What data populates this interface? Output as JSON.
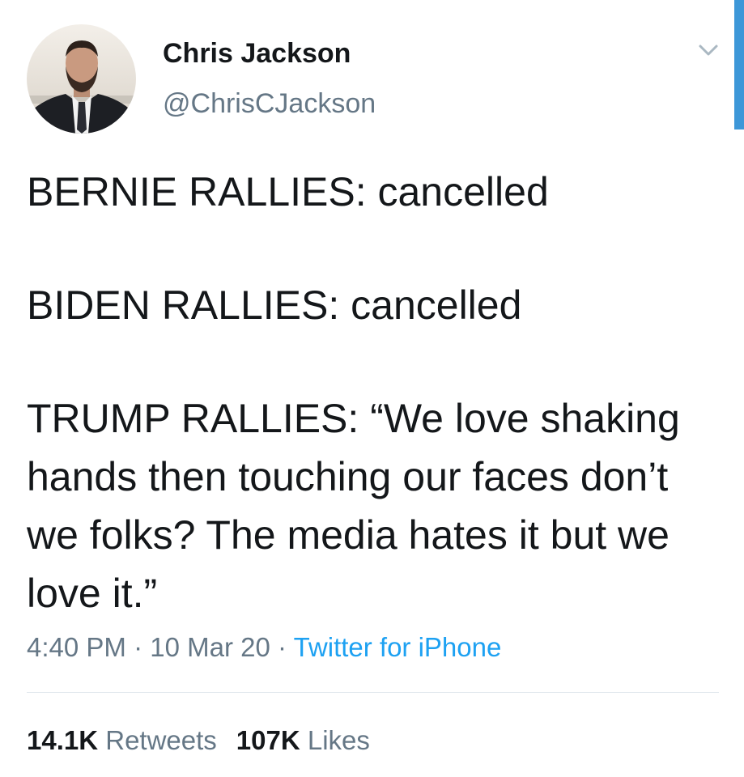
{
  "author": {
    "name": "Chris Jackson",
    "handle": "@ChrisCJackson"
  },
  "tweet": {
    "paragraphs": [
      "BERNIE RALLIES: cancelled",
      "BIDEN RALLIES: cancelled",
      "TRUMP RALLIES: “We love shaking hands then touching our faces don’t we folks? The media hates it but we love it.”"
    ]
  },
  "meta": {
    "time": "4:40 PM",
    "separator": " · ",
    "date": "10 Mar 20",
    "source": "Twitter for iPhone"
  },
  "stats": {
    "retweets_count": "14.1K",
    "retweets_label": "Retweets",
    "likes_count": "107K",
    "likes_label": "Likes"
  },
  "icons": {
    "more": "chevron-down-icon"
  },
  "colors": {
    "text": "#14171a",
    "secondary": "#657786",
    "link": "#1da1f2",
    "divider": "#e1e8ed",
    "scrollbar": "#3d97d8"
  }
}
